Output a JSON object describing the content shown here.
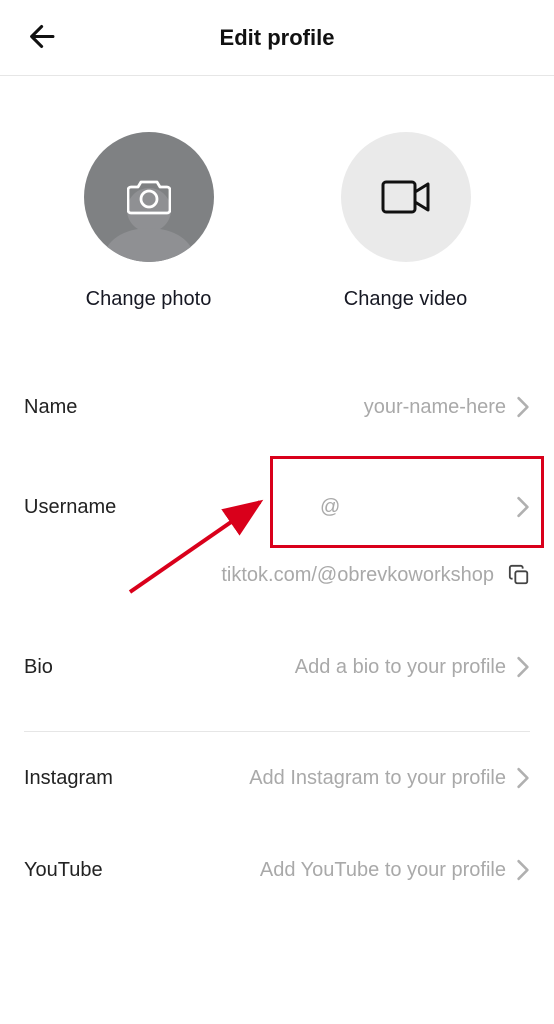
{
  "header": {
    "title": "Edit profile"
  },
  "media": {
    "photo_label": "Change photo",
    "video_label": "Change video"
  },
  "fields": {
    "name": {
      "label": "Name",
      "value": "your-name-here"
    },
    "username": {
      "label": "Username",
      "value": "@"
    },
    "bio": {
      "label": "Bio",
      "value": "Add a bio to your profile"
    },
    "instagram": {
      "label": "Instagram",
      "value": "Add Instagram to your profile"
    },
    "youtube": {
      "label": "YouTube",
      "value": "Add YouTube to your profile"
    }
  },
  "profile_url": "tiktok.com/@obrevkoworkshop"
}
